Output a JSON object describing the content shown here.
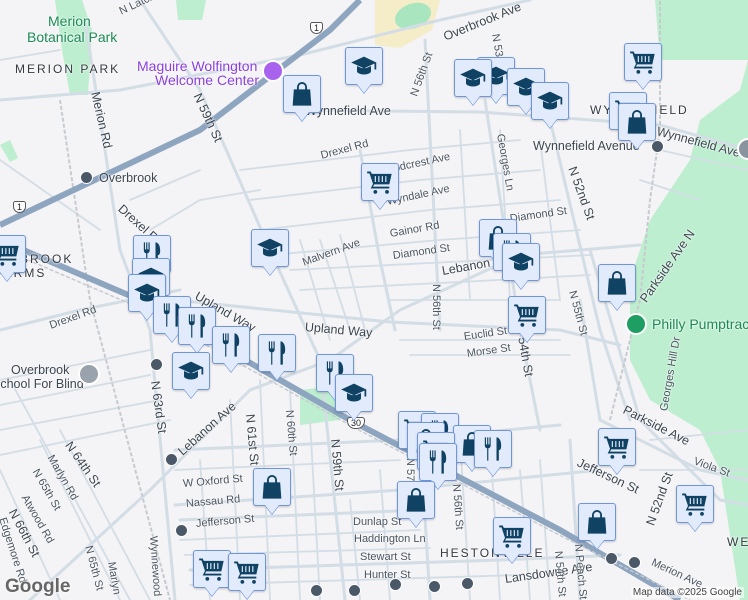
{
  "map": {
    "attribution": "Map data ©2025 Google",
    "logo": "Google",
    "shields": [
      "1",
      "1",
      "30"
    ],
    "marker_types": [
      "school-icon",
      "shopping-bag-icon",
      "shopping-cart-icon",
      "restaurant-icon"
    ],
    "colors": {
      "background": "#f4f3f5",
      "road": "#d3dde6",
      "highway": "#8ea5c0",
      "park": "#bdeed0",
      "marker_fill": "#e2ebfb",
      "marker_icon": "#0f4263"
    }
  },
  "labels": [
    "Merion",
    "Botanical Park",
    "MERION PARK",
    "N Latch",
    "Maguire Wolfington",
    "Welcome Center",
    "Overbrook Ave",
    "N 53rd St",
    "N 56th St",
    "Wynnefield Ave",
    "WYNNEFIELD",
    "Wynnefield Ave",
    "Wynnefield Avenue",
    "Merion Rd",
    "N 59th St",
    "Drexel Rd",
    "Overbrook",
    "Woodcrest Ave",
    "Wyndale Ave",
    "Gainor Rd",
    "Diamond St",
    "Diamond St",
    "Lebanon Ave",
    "Georges Ln",
    "N 52nd St",
    "Malvern Ave",
    "Drexel Rd",
    "OVERBROOK",
    "FARMS",
    "Upland Way",
    "Upland Way",
    "N 56th St",
    "N 55th St",
    "Euclid St",
    "Morse St",
    "N 54th St",
    "Philly Pumptrack",
    "Georges Hill Dr",
    "Parkside Ave N",
    "Parkside Ave",
    "Viola St",
    "N 52nd St",
    "Jefferson St",
    "Merion Ave",
    "WE",
    "Drexel Rd",
    "Overbrook",
    "School For Blind",
    "N 63rd St",
    "Lebanon Ave",
    "N 61st St",
    "N 60th St",
    "N 59th St",
    "N 64th St",
    "Marlyn Rd",
    "N 65th St",
    "Atwood Rd",
    "N 66th St",
    "Edgemore Rd",
    "N 65th St",
    "Marlyn",
    "Wynnewood",
    "W Oxford St",
    "Nassau Rd",
    "Jefferson St",
    "Dunlap St",
    "Haddington Ln",
    "Stewart St",
    "Hunter St",
    "HESTONVILLE",
    "Lansdowne Ave",
    "N 57th St",
    "N 56th St",
    "N 54th St",
    "N Peach St"
  ]
}
